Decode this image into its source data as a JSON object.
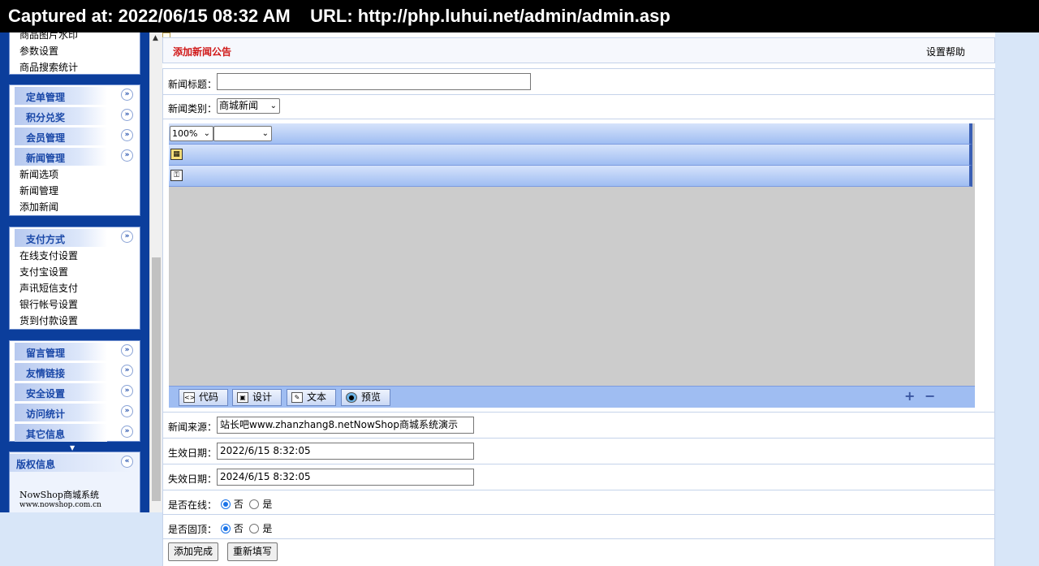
{
  "capture": {
    "text": "Captured at: 2022/06/15 08:32 AM    URL: http://php.luhui.net/admin/admin.asp"
  },
  "sidebar": {
    "box1_items": [
      "商品图片水印",
      "参数设置",
      "商品搜索统计"
    ],
    "groups_a": [
      "定单管理",
      "积分兑奖",
      "会员管理",
      "新闻管理"
    ],
    "news_items": [
      "新闻选项",
      "新闻管理",
      "添加新闻"
    ],
    "pay_group": "支付方式",
    "pay_items": [
      "在线支付设置",
      "支付宝设置",
      "声讯短信支付",
      "银行帐号设置",
      "货到付款设置"
    ],
    "groups_b": [
      "留言管理",
      "友情链接",
      "安全设置",
      "访问统计",
      "其它信息"
    ],
    "copyright_title": "版权信息",
    "copyright_lines": [
      "NowShop商城系统",
      "www.nowshop.com.cn"
    ]
  },
  "header": {
    "title": "添加新闻公告",
    "help": "设置帮助"
  },
  "form": {
    "title_label": "新闻标题：",
    "title_value": "",
    "category_label": "新闻类别：",
    "category_value": "商城新闻",
    "zoom_value": "100%",
    "editor_tabs": [
      "代码",
      "设计",
      "文本",
      "预览"
    ],
    "source_label": "新闻来源：",
    "source_value": "站长吧www.zhanzhang8.netNowShop商城系统演示",
    "start_label": "生效日期：",
    "start_value": "2022/6/15 8:32:05",
    "end_label": "失效日期：",
    "end_value": "2024/6/15 8:32:05",
    "online_label": "是否在线：",
    "top_label": "是否固顶：",
    "no": "否",
    "yes": "是",
    "submit": "添加完成",
    "reset": "重新填写"
  }
}
